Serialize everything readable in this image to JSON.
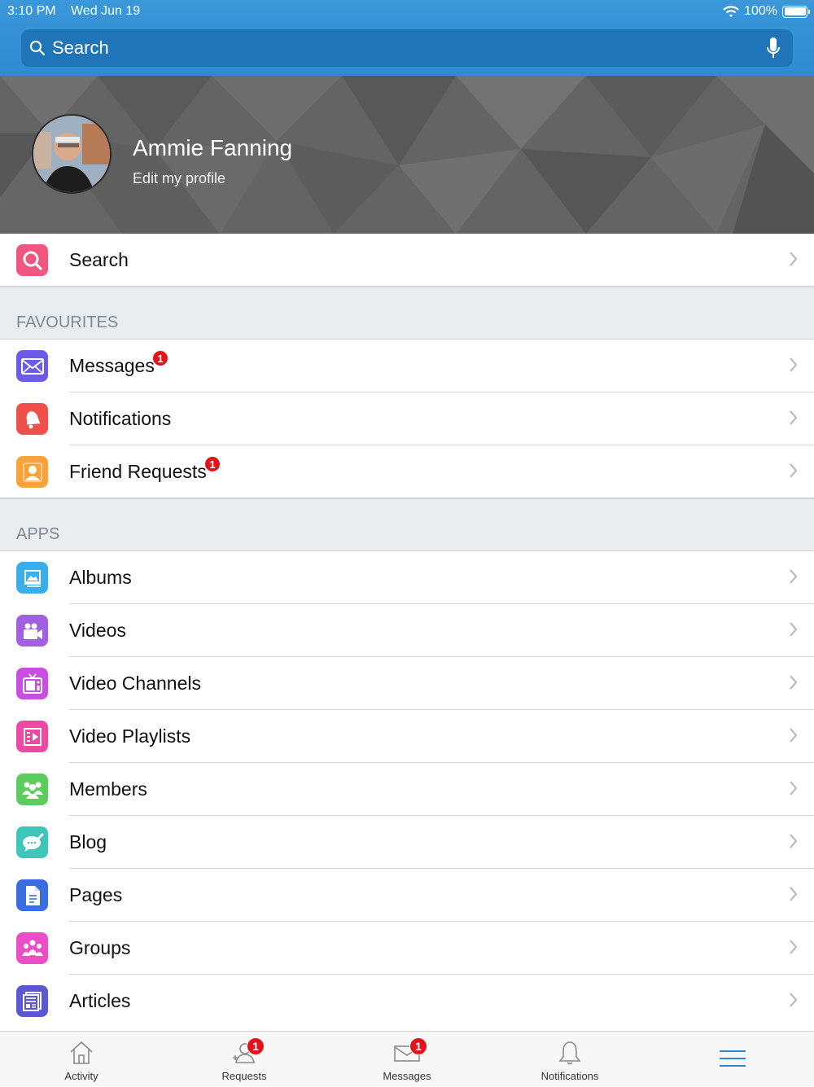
{
  "status_bar": {
    "time": "3:10 PM",
    "date": "Wed Jun 19",
    "battery": "100%"
  },
  "search_bar": {
    "placeholder": "Search"
  },
  "profile": {
    "name": "Ammie Fanning",
    "edit_label": "Edit my profile"
  },
  "search_row": {
    "label": "Search"
  },
  "favourites": {
    "title": "FAVOURITES",
    "items": [
      {
        "label": "Messages",
        "icon": "envelope-icon",
        "color": "#6b5ce7",
        "badge": "1"
      },
      {
        "label": "Notifications",
        "icon": "bell-icon",
        "color": "#f0504a",
        "badge": ""
      },
      {
        "label": "Friend Requests",
        "icon": "person-icon",
        "color": "#f7a23b",
        "badge": "1"
      }
    ]
  },
  "apps": {
    "title": "APPS",
    "items": [
      {
        "label": "Albums",
        "icon": "picture-icon",
        "color": "#3aaee8"
      },
      {
        "label": "Videos",
        "icon": "video-camera-icon",
        "color": "#a25fe0"
      },
      {
        "label": "Video Channels",
        "icon": "tv-icon",
        "color": "#c84fe0"
      },
      {
        "label": "Video Playlists",
        "icon": "playlist-icon",
        "color": "#ea4aa1"
      },
      {
        "label": "Members",
        "icon": "members-icon",
        "color": "#5ccc5f"
      },
      {
        "label": "Blog",
        "icon": "blog-icon",
        "color": "#3ec7b8"
      },
      {
        "label": "Pages",
        "icon": "document-icon",
        "color": "#3a6ee0"
      },
      {
        "label": "Groups",
        "icon": "groups-icon",
        "color": "#ea4fc6"
      },
      {
        "label": "Articles",
        "icon": "newspaper-icon",
        "color": "#5a57d0"
      }
    ]
  },
  "tab_bar": {
    "tabs": [
      {
        "label": "Activity",
        "icon": "home-icon",
        "badge": ""
      },
      {
        "label": "Requests",
        "icon": "friend-requests-icon",
        "badge": "1"
      },
      {
        "label": "Messages",
        "icon": "envelope-icon",
        "badge": "1"
      },
      {
        "label": "Notifications",
        "icon": "bell-icon",
        "badge": ""
      },
      {
        "label": "",
        "icon": "menu-icon",
        "badge": ""
      }
    ]
  }
}
